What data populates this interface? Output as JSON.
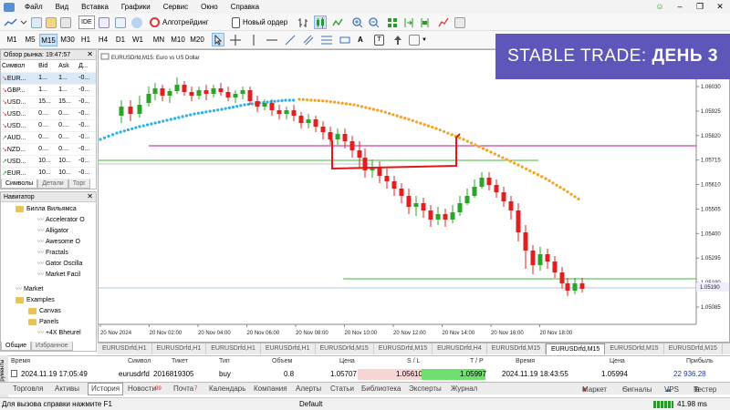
{
  "menu": [
    "Файл",
    "Вид",
    "Вставка",
    "Графики",
    "Сервис",
    "Окно",
    "Справка"
  ],
  "toolbar": {
    "ide": "IDE",
    "algo": "Алготрейдинг",
    "new_order": "Новый ордер"
  },
  "timeframes": [
    "M1",
    "M5",
    "M15",
    "M30",
    "H1",
    "H4",
    "D1",
    "W1",
    "MN",
    "M10",
    "M20"
  ],
  "timeframe_selected": "M15",
  "market_watch": {
    "title": "Обзор рынка: 19:47:57",
    "headers": [
      "Символ",
      "Bid",
      "Ask",
      "Д..."
    ],
    "rows": [
      [
        "EUR...",
        "1...",
        "1...",
        "-0..."
      ],
      [
        "GBP...",
        "1...",
        "1...",
        "-0..."
      ],
      [
        "USD...",
        "15...",
        "15...",
        "-0..."
      ],
      [
        "USD...",
        "0....",
        "0....",
        "-0..."
      ],
      [
        "USD...",
        "0....",
        "0....",
        "-0..."
      ],
      [
        "AUD...",
        "0....",
        "0....",
        "-0..."
      ],
      [
        "NZD...",
        "0....",
        "0....",
        "-0..."
      ],
      [
        "USD...",
        "10...",
        "10...",
        "-0..."
      ],
      [
        "EUR...",
        "10...",
        "10...",
        "-0..."
      ]
    ],
    "tabs": [
      "Символы",
      "Детали",
      "Торг"
    ]
  },
  "navigator": {
    "title": "Навигатор",
    "items": [
      "Билла Вильямса",
      "Accelerator O",
      "Alligator",
      "Awesome O",
      "Fractals",
      "Gator Oscilla",
      "Market Facil",
      "Market",
      "Examples",
      "Canvas",
      "Panels",
      "+4X Bheurel"
    ],
    "tabs": [
      "Общие",
      "Избранное"
    ]
  },
  "chart": {
    "title": "EURUSDrfd,M15: Euro vs US Dollar",
    "price_labels": [
      "1.06030",
      "1.05925",
      "1.05820",
      "1.05715",
      "1.05610",
      "1.05505",
      "1.05400",
      "1.05295",
      "1.05190",
      "1.05085"
    ],
    "current_price": "1.05190",
    "time_labels": [
      "20 Nov 2024",
      "20 Nov 02:00",
      "20 Nov 04:00",
      "20 Nov 06:00",
      "20 Nov 08:00",
      "20 Nov 10:00",
      "20 Nov 12:00",
      "20 Nov 14:00",
      "20 Nov 16:00",
      "20 Nov 18:00"
    ]
  },
  "banner": {
    "normal": "STABLE TRADE: ",
    "bold": "ДЕНЬ 3"
  },
  "chart_tabs": [
    "EURUSDrfd,H1",
    "EURUSDrfd,H1",
    "EURUSDrfd,H1",
    "EURUSDrfd,H1",
    "EURUSDrfd,M15",
    "EURUSDrfd,M15",
    "EURUSDrfd,H4",
    "EURUSDrfd,M15",
    "EURUSDrfd,M15",
    "EURUSDrfd,M15",
    "EURUSDrfd,M15"
  ],
  "chart_tab_active": 8,
  "history": {
    "headers": [
      "Время",
      "Символ",
      "Тикет",
      "Тип",
      "Объем",
      "Цена",
      "S / L",
      "T / P",
      "Время",
      "Цена",
      "Прибыль"
    ],
    "row": [
      "2024.11.19 17:05:49",
      "eurusdrfd",
      "2016819305",
      "buy",
      "0.8",
      "1.05707",
      "1.05610",
      "1.05997",
      "2024.11.19 18:43:55",
      "1.05994",
      "22 936.28"
    ]
  },
  "side_label": "Инструменты",
  "bottom_tabs": [
    "Торговля",
    "Активы",
    "История",
    "Новости",
    "Почта",
    "Календарь",
    "Компания",
    "Алерты",
    "Статьи",
    "Библиотека",
    "Эксперты",
    "Журнал"
  ],
  "bottom_badges": {
    "news": "99",
    "mail": "7"
  },
  "bottom_right": [
    "Маркет",
    "Сигналы",
    "VPS",
    "Тестер"
  ],
  "status": {
    "help": "Для вызова справки нажмите F1",
    "profile": "Default",
    "ping": "41.98 ms"
  },
  "colors": {
    "bull": "#2aa52a",
    "bear": "#e02020",
    "banner": "#5e56b8",
    "ma_blue": "#2bb0e8",
    "ma_orange": "#f4a020",
    "level_magenta": "#c01a8a",
    "level_green": "#3cb83c",
    "selection_red": "#e01818"
  }
}
